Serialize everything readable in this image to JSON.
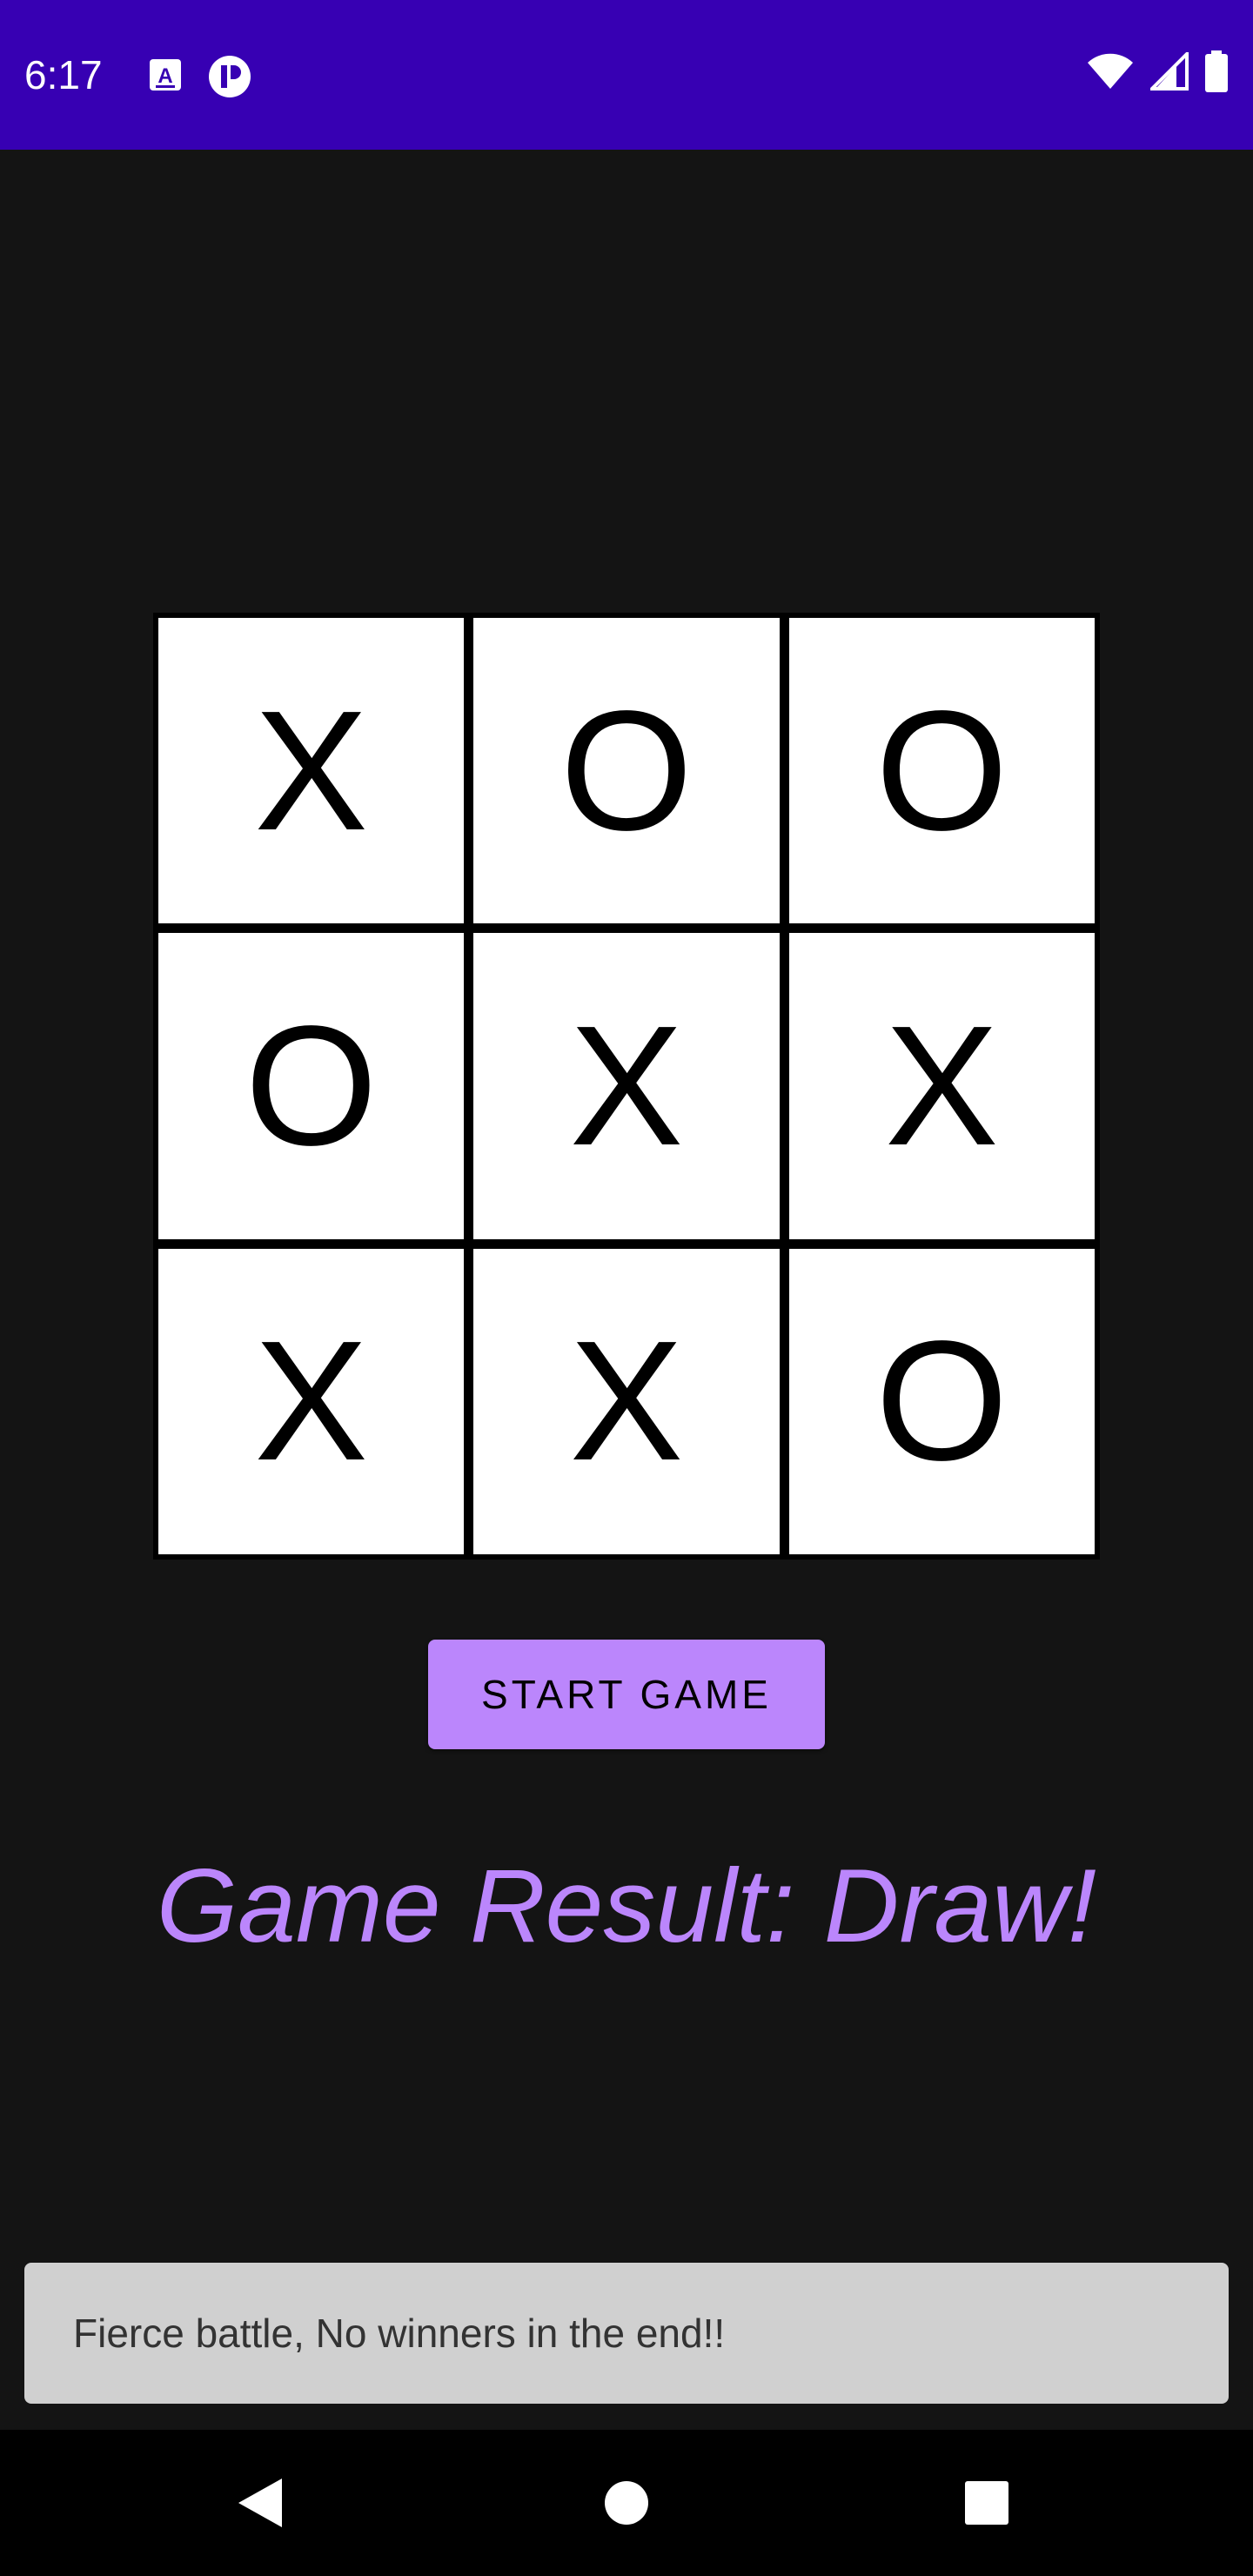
{
  "status_bar": {
    "time": "6:17",
    "icons": [
      "text-a-icon",
      "notification-app-icon",
      "wifi-icon",
      "cell-signal-icon",
      "battery-icon"
    ],
    "background": "#3700b3"
  },
  "board": {
    "cells": [
      "X",
      "O",
      "O",
      "O",
      "X",
      "X",
      "X",
      "X",
      "O"
    ]
  },
  "start_button": {
    "label": "START GAME",
    "color": "#bb86fc"
  },
  "result": {
    "text": "Game Result: Draw!",
    "color": "#bb86fc"
  },
  "snackbar": {
    "message": "Fierce battle, No winners in the end!!"
  },
  "nav_bar": {
    "icons": [
      "back-icon",
      "home-icon",
      "recents-icon"
    ]
  }
}
